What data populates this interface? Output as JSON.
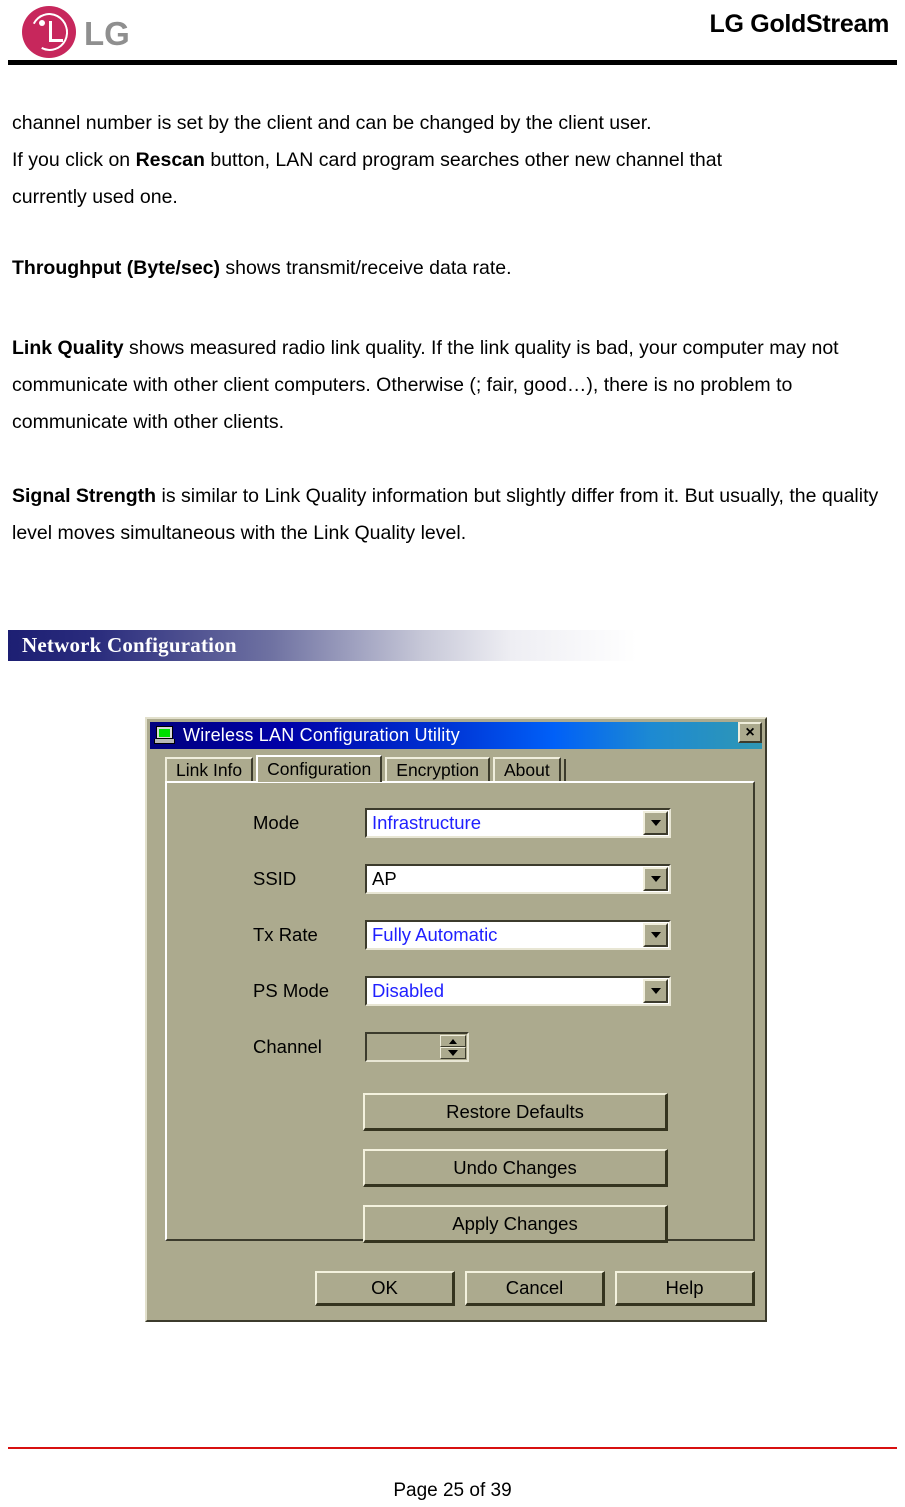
{
  "header": {
    "logo_icon": "lg-circle-logo",
    "logo_word": "LG",
    "brand_title": "LG GoldStream"
  },
  "body": {
    "para_1_line_1": "channel number is set by the client and can be changed by the client user.",
    "para_1_line_2_pre": "If you click on ",
    "para_1_line_2_bold": "Rescan",
    "para_1_line_2_post": " button, LAN card program searches other new channel that",
    "para_1_line_3": "currently used one.",
    "para_2_bold": "Throughput (Byte/sec)",
    "para_2_rest": " shows transmit/receive data rate.",
    "para_3_bold": "Link Quality",
    "para_3_rest": " shows measured radio link quality. If the link quality is bad, your computer may not communicate with other client computers. Otherwise (; fair, good…), there is no problem to communicate with other clients.",
    "para_4_bold": "Signal Strength",
    "para_4_rest": " is similar to Link Quality information but slightly differ from it. But usually, the quality level moves simultaneous with the Link Quality level."
  },
  "section": {
    "title": "Network Configuration",
    "gradient_start": "#1d1f73",
    "gradient_end": "#ffffff"
  },
  "dialog": {
    "title": "Wireless LAN Configuration Utility",
    "title_icon": "monitor-icon",
    "close_label": "×",
    "titlebar_color_start": "#00007e",
    "titlebar_color_end": "#2f97b4",
    "background_color": "#acaa8e",
    "tabs": [
      {
        "label": "Link Info",
        "active": false
      },
      {
        "label": "Configuration",
        "active": true
      },
      {
        "label": "Encryption",
        "active": false
      },
      {
        "label": "About",
        "active": false
      }
    ],
    "fields": [
      {
        "label": "Mode",
        "value": "Infrastructure",
        "type": "dropdown",
        "value_color": "#2020ff"
      },
      {
        "label": "SSID",
        "value": "AP",
        "type": "combo-editable",
        "value_color": "#000000"
      },
      {
        "label": "Tx Rate",
        "value": "Fully Automatic",
        "type": "dropdown",
        "value_color": "#2020ff"
      },
      {
        "label": "PS Mode",
        "value": "Disabled",
        "type": "dropdown",
        "value_color": "#2020ff"
      },
      {
        "label": "Channel",
        "value": "",
        "type": "spinner",
        "value_color": "#000000"
      }
    ],
    "panel_buttons": [
      {
        "label": "Restore Defaults"
      },
      {
        "label": "Undo Changes"
      },
      {
        "label": "Apply Changes"
      }
    ],
    "bottom_buttons": [
      {
        "label": "OK"
      },
      {
        "label": "Cancel"
      },
      {
        "label": "Help"
      }
    ]
  },
  "footer": {
    "page_label": "Page 25 of 39",
    "rule_color": "#d81010"
  }
}
